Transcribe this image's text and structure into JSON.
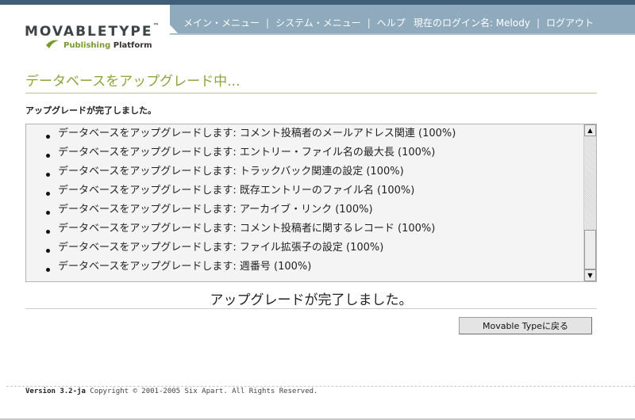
{
  "header": {
    "logo_main": "MOVABLETYPE",
    "logo_tm": "™",
    "logo_sub_a": "Publishing",
    "logo_sub_b": "Platform",
    "nav": {
      "main_menu": "メイン・メニュー",
      "system_menu": "システム・メニュー",
      "help": "ヘルプ",
      "sep": "|",
      "login_label": "現在のログイン名: Melody",
      "logout": "ログアウト"
    }
  },
  "main": {
    "title": "データベースをアップグレード中...",
    "done_label": "アップグレードが完了しました。",
    "log_items": [
      "データベースをアップグレードします: コメント投稿者のメールアドレス関連 (100%)",
      "データベースをアップグレードします: エントリー・ファイル名の最大長 (100%)",
      "データベースをアップグレードします: トラックバック関連の設定 (100%)",
      "データベースをアップグレードします: 既存エントリーのファイル名 (100%)",
      "データベースをアップグレードします: アーカイブ・リンク (100%)",
      "データベースをアップグレードします: コメント投稿者に関するレコード (100%)",
      "データベースをアップグレードします: ファイル拡張子の設定 (100%)",
      "データベースをアップグレードします: 週番号 (100%)"
    ],
    "complete_message": "アップグレードが完了しました。",
    "return_button": "Movable Typeに戻る"
  },
  "footer": {
    "version": "Version 3.2-ja",
    "copyright": "Copyright © 2001-2005 Six Apart. All Rights Reserved."
  },
  "colors": {
    "accent_green": "#8aa63a",
    "nav_blue": "#8fa9bd"
  }
}
